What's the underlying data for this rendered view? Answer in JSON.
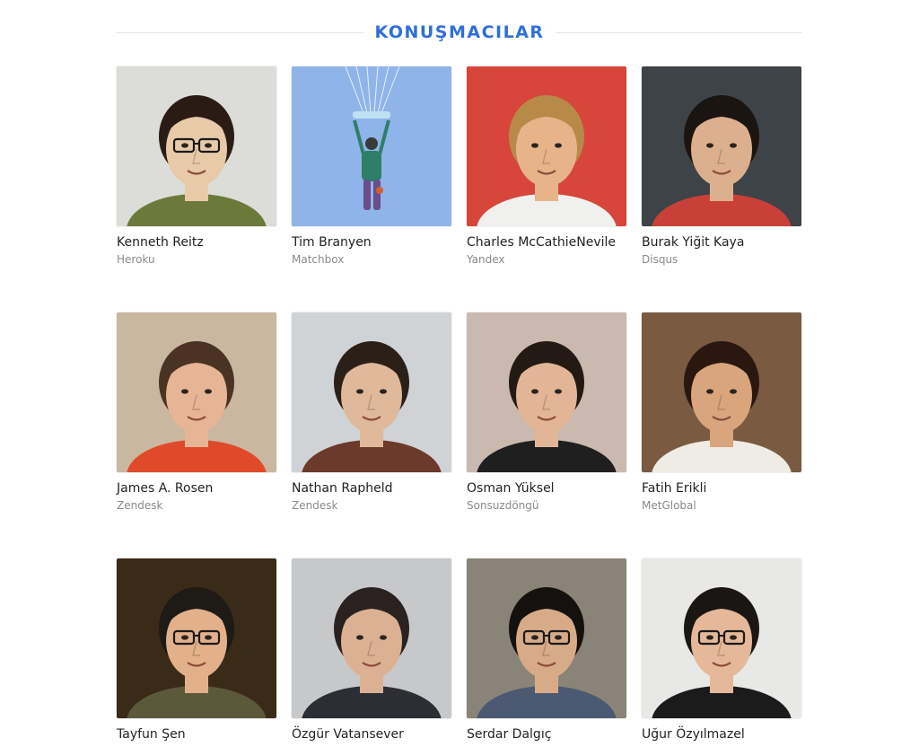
{
  "section": {
    "title": "KONUŞMACILAR"
  },
  "speakers": [
    {
      "name": "Kenneth Reitz",
      "company": "Heroku",
      "bg": "#dcdcd8",
      "skin": "#e8c9a8",
      "hair": "#2a1c14",
      "shirt": "#6b7a3a",
      "glasses": true,
      "icon": "speaker-photo-kenneth-reitz"
    },
    {
      "name": "Tim Branyen",
      "company": "Matchbox",
      "bg": "#8fb4ea",
      "skin": "#2d7f6a",
      "hair": "#2d7f6a",
      "shirt": "#6a4d8a",
      "glasses": false,
      "icon": "speaker-photo-tim-branyen",
      "parachute": true
    },
    {
      "name": "Charles McCathieNevile",
      "company": "Yandex",
      "bg": "#d8453a",
      "skin": "#e7b48a",
      "hair": "#b88a4a",
      "shirt": "#f0f0ee",
      "glasses": false,
      "icon": "speaker-photo-charles-mccathienevile"
    },
    {
      "name": "Burak Yiğit Kaya",
      "company": "Disqus",
      "bg": "#3e4348",
      "skin": "#dcb08e",
      "hair": "#1b1512",
      "shirt": "#c84038",
      "glasses": false,
      "icon": "speaker-photo-burak-yigit-kaya"
    },
    {
      "name": "James A. Rosen",
      "company": "Zendesk",
      "bg": "#c9b79f",
      "skin": "#e6b595",
      "hair": "#4a3322",
      "shirt": "#e04a2a",
      "glasses": false,
      "icon": "speaker-photo-james-a-rosen"
    },
    {
      "name": "Nathan Rapheld",
      "company": "Zendesk",
      "bg": "#cfd3d6",
      "skin": "#e0b89a",
      "hair": "#2b2018",
      "shirt": "#6b3a2a",
      "glasses": false,
      "icon": "speaker-photo-nathan-rapheld"
    },
    {
      "name": "Osman Yüksel",
      "company": "Sonsuzdöngü",
      "bg": "#c9b9ae",
      "skin": "#e2b596",
      "hair": "#231a14",
      "shirt": "#1f1f1f",
      "glasses": false,
      "icon": "speaker-photo-osman-yuksel"
    },
    {
      "name": "Fatih Erikli",
      "company": "MetGlobal",
      "bg": "#7a5a40",
      "skin": "#d9a57c",
      "hair": "#2a1810",
      "shirt": "#efece6",
      "glasses": false,
      "icon": "speaker-photo-fatih-erikli"
    },
    {
      "name": "Tayfun Şen",
      "company": "",
      "bg": "#3a2a18",
      "skin": "#e2b08a",
      "hair": "#1e1a16",
      "shirt": "#5a5a3a",
      "glasses": true,
      "icon": "speaker-photo-tayfun-sen"
    },
    {
      "name": "Özgür Vatansever",
      "company": "",
      "bg": "#c7c8ca",
      "skin": "#dcb193",
      "hair": "#2a2220",
      "shirt": "#2b2e33",
      "glasses": false,
      "icon": "speaker-photo-ozgur-vatansever"
    },
    {
      "name": "Serdar Dalgıç",
      "company": "",
      "bg": "#8a8478",
      "skin": "#d8ab88",
      "hair": "#15110e",
      "shirt": "#4b5a72",
      "glasses": true,
      "icon": "speaker-photo-serdar-dalgic"
    },
    {
      "name": "Uğur Özyılmazel",
      "company": "",
      "bg": "#e8e8e6",
      "skin": "#e4b898",
      "hair": "#1a1614",
      "shirt": "#1b1b1b",
      "glasses": true,
      "icon": "speaker-photo-ugur-ozyilmazel"
    }
  ]
}
